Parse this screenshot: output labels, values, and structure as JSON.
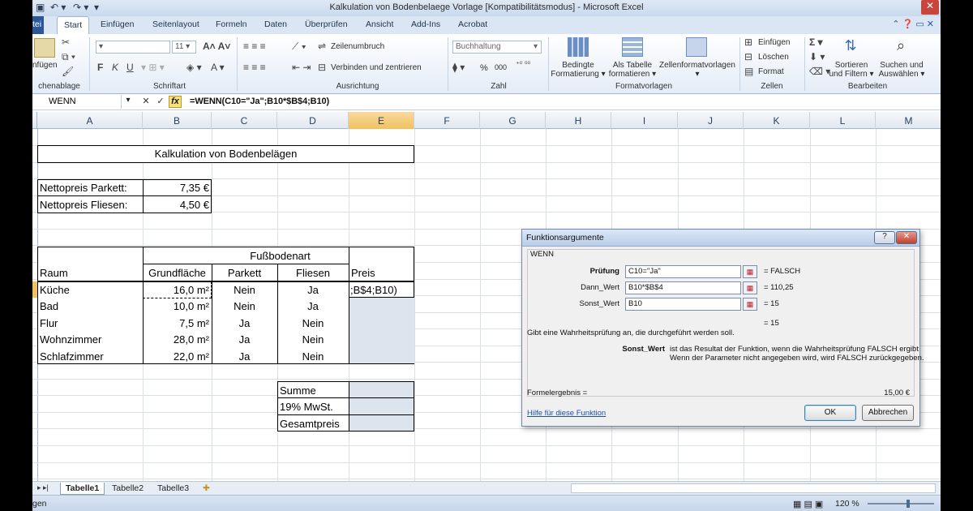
{
  "window": {
    "title": "Kalkulation von Bodenbelaege Vorlage  [Kompatibilitätsmodus]  -  Microsoft Excel",
    "quick_access": [
      "save-icon",
      "undo-icon",
      "redo-icon"
    ]
  },
  "ribbon": {
    "file_tab_fragment": "tei",
    "tabs": [
      "Start",
      "Einfügen",
      "Seitenlayout",
      "Formeln",
      "Daten",
      "Überprüfen",
      "Ansicht",
      "Add-Ins",
      "Acrobat"
    ],
    "active_tab": "Start",
    "clipboard": {
      "paste_label": "nfügen",
      "group": "chenablage"
    },
    "font": {
      "size": "11",
      "bold": "F",
      "italic": "K",
      "underline": "U",
      "group": "Schriftart"
    },
    "alignment": {
      "wrap": "Zeilenumbruch",
      "merge": "Verbinden und zentrieren",
      "group": "Ausrichtung"
    },
    "number": {
      "format": "Buchhaltung",
      "percent": "%",
      "thousands": "000",
      "group": "Zahl"
    },
    "styles": {
      "conditional": [
        "Bedingte",
        "Formatierung"
      ],
      "as_table": [
        "Als Tabelle",
        "formatieren"
      ],
      "cell_styles": "Zellenformatvorlagen",
      "group": "Formatvorlagen"
    },
    "cells": {
      "insert": "Einfügen",
      "delete": "Löschen",
      "format": "Format",
      "group": "Zellen"
    },
    "editing": {
      "sort": [
        "Sortieren",
        "und Filtern"
      ],
      "find": [
        "Suchen und",
        "Auswählen"
      ],
      "group": "Bearbeiten"
    }
  },
  "formula_bar": {
    "name_box": "WENN",
    "fx": "fx",
    "formula": "=WENN(C10=\"Ja\";B10*$B$4;B10)"
  },
  "columns": [
    "A",
    "B",
    "C",
    "D",
    "E",
    "F",
    "G",
    "H",
    "I",
    "J",
    "K",
    "L",
    "M"
  ],
  "selected_column": "E",
  "sheet": {
    "title": "Kalkulation von Bodenbelägen",
    "prices": [
      {
        "label": "Nettopreis Parkett:",
        "value": "7,35 €"
      },
      {
        "label": "Nettopreis Fliesen:",
        "value": "4,50 €"
      }
    ],
    "header_group": "Fußbodenart",
    "headers": [
      "Raum",
      "Grundfläche",
      "Parkett",
      "Fliesen",
      "Preis"
    ],
    "rows": [
      {
        "raum": "Küche",
        "flaeche": "16,0 m²",
        "parkett": "Nein",
        "fliesen": "Ja",
        "preis": ";B$4;B10)"
      },
      {
        "raum": "Bad",
        "flaeche": "10,0 m²",
        "parkett": "Nein",
        "fliesen": "Ja",
        "preis": ""
      },
      {
        "raum": "Flur",
        "flaeche": "7,5 m²",
        "parkett": "Ja",
        "fliesen": "Nein",
        "preis": ""
      },
      {
        "raum": "Wohnzimmer",
        "flaeche": "28,0 m²",
        "parkett": "Ja",
        "fliesen": "Nein",
        "preis": ""
      },
      {
        "raum": "Schlafzimmer",
        "flaeche": "22,0 m²",
        "parkett": "Ja",
        "fliesen": "Nein",
        "preis": ""
      }
    ],
    "summary": [
      "Summe",
      "19% MwSt.",
      "Gesamtpreis"
    ]
  },
  "sheet_tabs": [
    "Tabelle1",
    "Tabelle2",
    "Tabelle3"
  ],
  "active_sheet": "Tabelle1",
  "status": {
    "mode": "gen",
    "zoom": "120 %"
  },
  "dialog": {
    "title": "Funktionsargumente",
    "function_name": "WENN",
    "args": [
      {
        "label": "Prüfung",
        "value": "C10=\"Ja\"",
        "result": "=  FALSCH"
      },
      {
        "label": "Dann_Wert",
        "value": "B10*$B$4",
        "result": "=  110,25"
      },
      {
        "label": "Sonst_Wert",
        "value": "B10",
        "result": "=  15"
      }
    ],
    "total_result": "=  15",
    "description": "Gibt eine Wahrheitsprüfung an, die durchgeführt werden soll.",
    "arg_help_name": "Sonst_Wert",
    "arg_help_text": [
      "ist das Resultat der Funktion, wenn die Wahrheitsprüfung FALSCH ergibt",
      "Wenn der Parameter nicht angegeben wird, wird FALSCH zurückgegeben."
    ],
    "formula_result_label": "Formelergebnis =",
    "formula_result_value": "15,00 €",
    "help_link": "Hilfe für diese Funktion",
    "ok_label": "OK",
    "cancel_label": "Abbrechen",
    "help_button": "?",
    "close_button": "✕"
  }
}
